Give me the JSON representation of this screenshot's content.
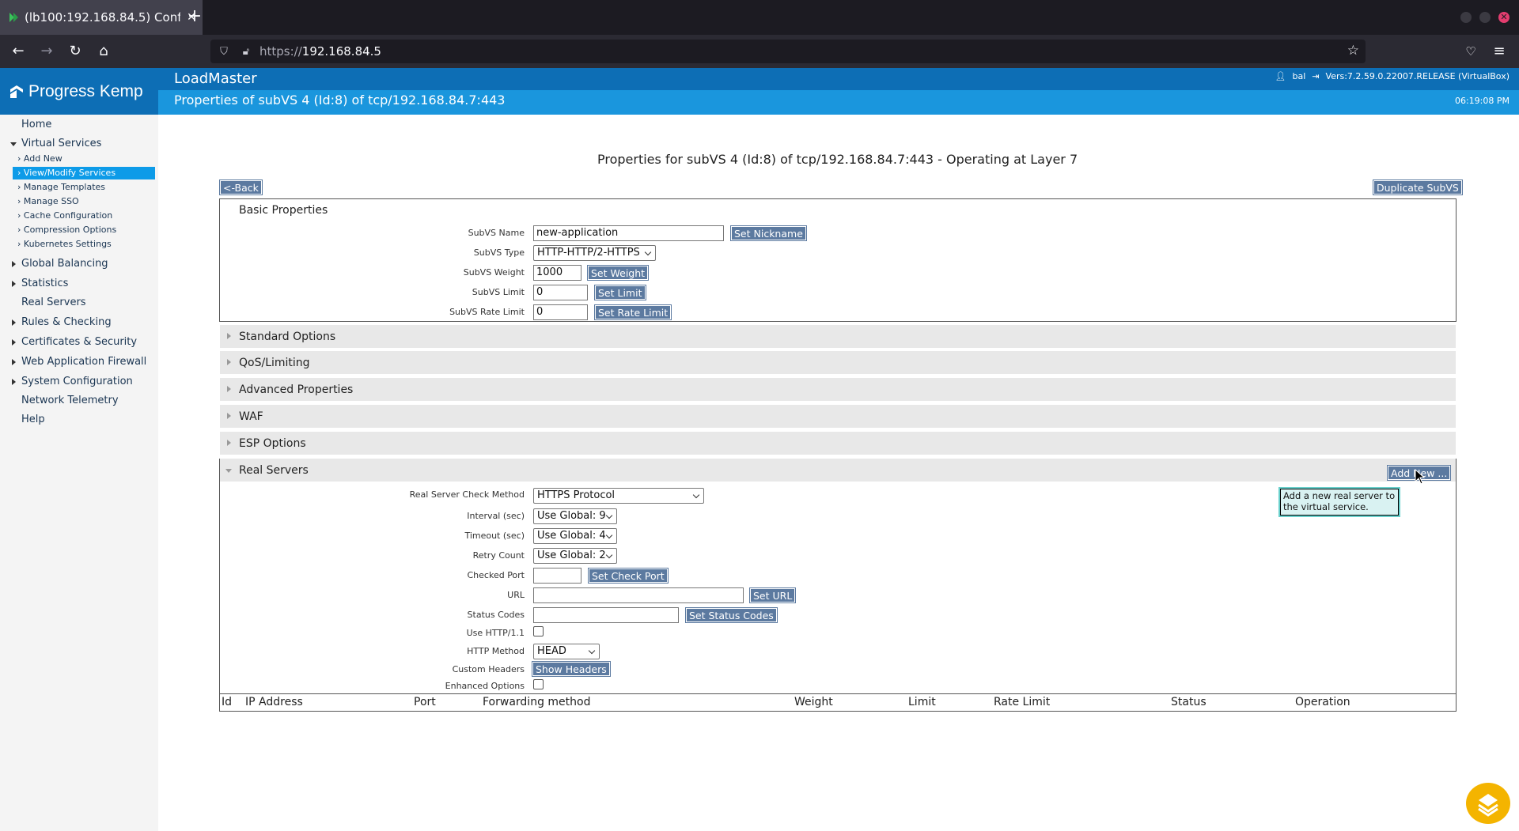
{
  "browser": {
    "tab_title": "(lb100:192.168.84.5) Conf",
    "url_protocol": "https://",
    "url_host": "192.168.84.5"
  },
  "header": {
    "brand": "Progress Kemp",
    "product": "LoadMaster",
    "subtitle": "Properties of subVS 4 (Id:8) of tcp/192.168.84.7:443",
    "user": "bal",
    "version": "Vers:7.2.59.0.22007.RELEASE (VirtualBox)",
    "time": "06:19:08 PM"
  },
  "sidebar": {
    "home": "Home",
    "virtual_services": "Virtual Services",
    "vs_items": [
      "Add New",
      "View/Modify Services",
      "Manage Templates",
      "Manage SSO",
      "Cache Configuration",
      "Compression Options",
      "Kubernetes Settings"
    ],
    "global_balancing": "Global Balancing",
    "statistics": "Statistics",
    "real_servers": "Real Servers",
    "rules": "Rules & Checking",
    "certs": "Certificates & Security",
    "waf": "Web Application Firewall",
    "system": "System Configuration",
    "telemetry": "Network Telemetry",
    "help": "Help"
  },
  "main": {
    "title": "Properties for subVS 4 (Id:8) of tcp/192.168.84.7:443 - Operating at Layer 7",
    "back": "<-Back",
    "duplicate": "Duplicate SubVS",
    "basic": {
      "heading": "Basic Properties",
      "name_label": "SubVS Name",
      "name_value": "new-application",
      "set_nickname": "Set Nickname",
      "type_label": "SubVS Type",
      "type_value": "HTTP-HTTP/2-HTTPS",
      "weight_label": "SubVS Weight",
      "weight_value": "1000",
      "set_weight": "Set Weight",
      "limit_label": "SubVS Limit",
      "limit_value": "0",
      "set_limit": "Set Limit",
      "rate_label": "SubVS Rate Limit",
      "rate_value": "0",
      "set_rate": "Set Rate Limit"
    },
    "sections": [
      "Standard Options",
      "QoS/Limiting",
      "Advanced Properties",
      "WAF",
      "ESP Options"
    ],
    "real_servers": {
      "heading": "Real Servers",
      "add_new": "Add New ...",
      "tooltip": "Add a new real server to the virtual service.",
      "check_method_label": "Real Server Check Method",
      "check_method_value": "HTTPS Protocol",
      "interval_label": "Interval (sec)",
      "interval_value": "Use Global: 9",
      "timeout_label": "Timeout (sec)",
      "timeout_value": "Use Global: 4",
      "retry_label": "Retry Count",
      "retry_value": "Use Global: 2",
      "port_label": "Checked Port",
      "set_port": "Set Check Port",
      "url_label": "URL",
      "set_url": "Set URL",
      "status_label": "Status Codes",
      "set_status": "Set Status Codes",
      "http11_label": "Use HTTP/1.1",
      "method_label": "HTTP Method",
      "method_value": "HEAD",
      "headers_label": "Custom Headers",
      "show_headers": "Show Headers",
      "enhanced_label": "Enhanced Options",
      "columns": [
        "Id",
        "IP Address",
        "Port",
        "Forwarding method",
        "Weight",
        "Limit",
        "Rate Limit",
        "Status",
        "Operation"
      ]
    }
  }
}
